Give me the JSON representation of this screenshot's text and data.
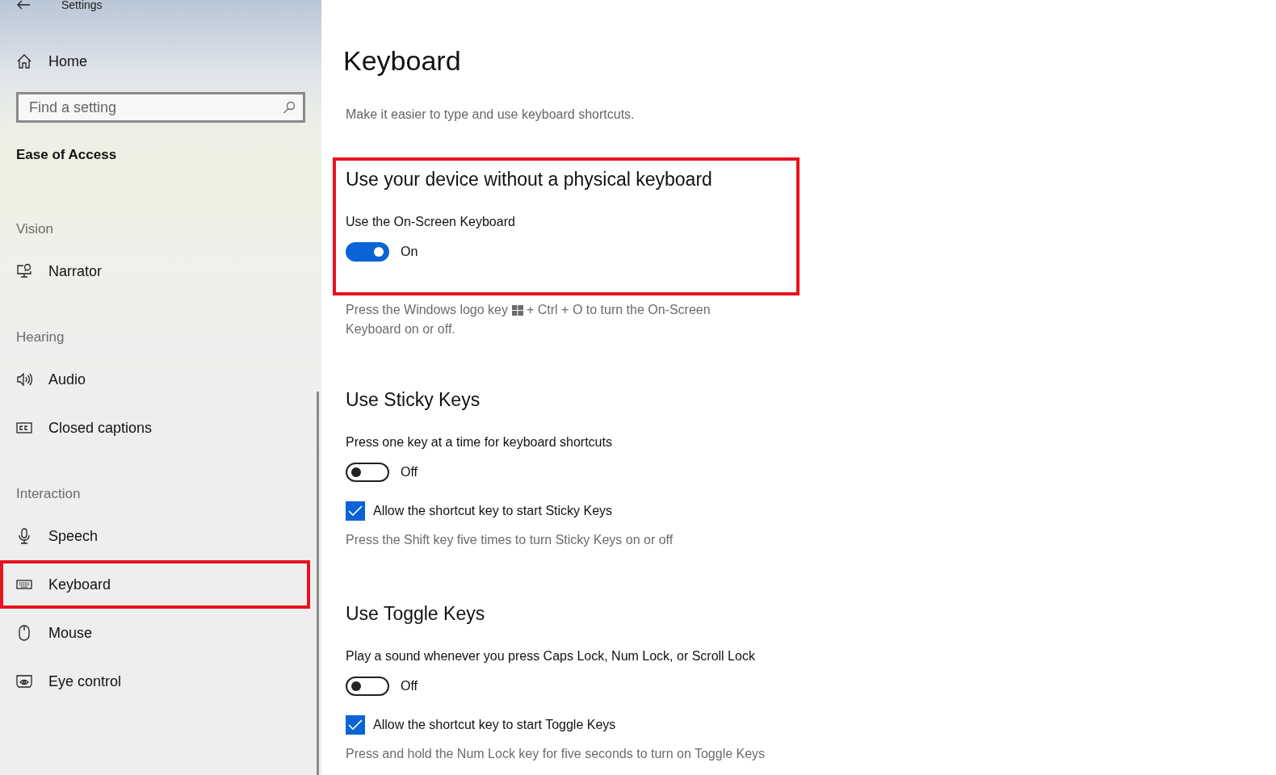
{
  "window": {
    "title": "Settings"
  },
  "sidebar": {
    "home": "Home",
    "search": {
      "placeholder": "Find a setting"
    },
    "category": "Ease of Access",
    "groups": [
      {
        "title": "Vision",
        "items": [
          {
            "label": "Narrator",
            "highlighted": false
          }
        ]
      },
      {
        "title": "Hearing",
        "items": [
          {
            "label": "Audio",
            "highlighted": false
          },
          {
            "label": "Closed captions",
            "highlighted": false
          }
        ]
      },
      {
        "title": "Interaction",
        "items": [
          {
            "label": "Speech",
            "highlighted": false
          },
          {
            "label": "Keyboard",
            "highlighted": true
          },
          {
            "label": "Mouse",
            "highlighted": false
          },
          {
            "label": "Eye control",
            "highlighted": false
          }
        ]
      }
    ]
  },
  "main": {
    "title": "Keyboard",
    "subtitle": "Make it easier to type and use keyboard shortcuts.",
    "blocks": [
      {
        "kind": "section",
        "heading": "Use your device without a physical keyboard",
        "highlighted": true,
        "items": [
          {
            "kind": "toggle",
            "label": "Use the On-Screen Keyboard",
            "on": true,
            "state_text": "On"
          }
        ]
      },
      {
        "kind": "key-note",
        "before": "Press the Windows logo key",
        "after": "+ Ctrl + O to turn the On-Screen",
        "continuation": "Keyboard on or off."
      },
      {
        "kind": "section",
        "heading": "Use Sticky Keys",
        "highlighted": false,
        "items": [
          {
            "kind": "toggle",
            "label": "Press one key at a time for keyboard shortcuts",
            "on": false,
            "state_text": "Off"
          },
          {
            "kind": "checkbox",
            "label": "Allow the shortcut key to start Sticky Keys",
            "checked": true
          },
          {
            "kind": "note",
            "text": "Press the Shift key five times to turn Sticky Keys on or off"
          }
        ]
      },
      {
        "kind": "section",
        "heading": "Use Toggle Keys",
        "highlighted": false,
        "items": [
          {
            "kind": "toggle",
            "label": "Play a sound whenever you press Caps Lock, Num Lock, or Scroll Lock",
            "on": false,
            "state_text": "Off"
          },
          {
            "kind": "checkbox",
            "label": "Allow the shortcut key to start Toggle Keys",
            "checked": true
          },
          {
            "kind": "note",
            "text": "Press and hold the Num Lock key for five seconds to turn on Toggle Keys"
          }
        ]
      }
    ]
  }
}
